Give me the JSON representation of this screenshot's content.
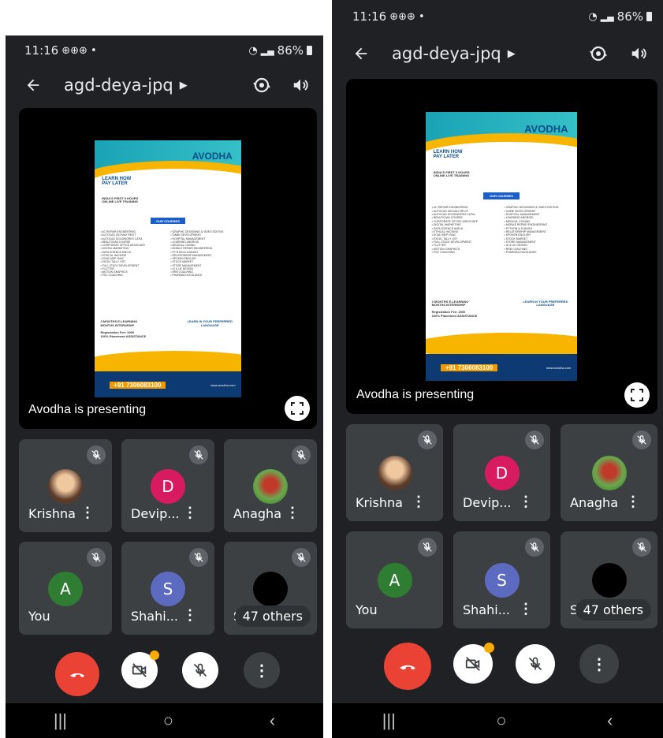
{
  "phones": [
    {
      "status": {
        "time": "11:16",
        "battery": "86%"
      },
      "meeting_code": "agd-deya-jpq",
      "presenting_label": "Avodha is presenting",
      "tiles": [
        {
          "name": "Krishna",
          "avatar_letter": "",
          "avatar_color": "#8d6e63"
        },
        {
          "name": "Devip...",
          "avatar_letter": "D",
          "avatar_color": "#d81b60"
        },
        {
          "name": "Anagha",
          "avatar_letter": "",
          "avatar_color": "#4caf50"
        },
        {
          "name": "You",
          "avatar_letter": "A",
          "avatar_color": "#2e7d32"
        },
        {
          "name": "Shahi...",
          "avatar_letter": "S",
          "avatar_color": "#5c6bc0"
        },
        {
          "name": "Sr",
          "avatar_letter": "",
          "avatar_color": "#000000",
          "others_label": "47 others"
        }
      ]
    },
    {
      "status": {
        "time": "11:16",
        "battery": "86%"
      },
      "meeting_code": "agd-deya-jpq",
      "presenting_label": "Avodha is presenting",
      "tiles": [
        {
          "name": "Krishna",
          "avatar_letter": "",
          "avatar_color": "#8d6e63"
        },
        {
          "name": "Devip...",
          "avatar_letter": "D",
          "avatar_color": "#d81b60"
        },
        {
          "name": "Anagha",
          "avatar_letter": "",
          "avatar_color": "#4caf50"
        },
        {
          "name": "You",
          "avatar_letter": "A",
          "avatar_color": "#2e7d32"
        },
        {
          "name": "Shahi...",
          "avatar_letter": "S",
          "avatar_color": "#5c6bc0"
        },
        {
          "name": "Sr",
          "avatar_letter": "",
          "avatar_color": "#000000",
          "others_label": "47 others"
        }
      ]
    }
  ],
  "poster": {
    "brand": "AVODHA",
    "headline_1": "LEARN HOW",
    "headline_2": "PAY LATER",
    "sub_1": "INDIA'S FIRST 9 HOURS",
    "sub_2": "ONLINE LIVE TRAINING",
    "courses_bar": "OUR COURSES",
    "courses_left": "• AC REPAIR ENGINEERING\n• AUTOCAD 2D3 MAX REVIT\n• AUTOCAD SOLIDWORKS CATIA\n• BEAUTICIAN COURSE\n• CORPORATE OFFICE ASSOCIATE\n• DIGITAL MARKETING\n• DATA SCIENCE AND AI\n• ETHICAL HACKING\n• ECAD MEP HVAC\n• EXCEL TALLY GST\n• FULL STACK DEVELOPMENT\n• FLUTTER\n• MOTION GRAPHICS\n• PSC COACHING",
    "courses_right": "• GRAPHIC DESIGNING & VIDEO EDITING\n• GAME DEVELOPMENT\n• HOSPITAL MANAGEMENT\n• LEARNING ANDROID\n• MEDICAL CODING\n• MOBILE REPAIR ENGINEERING\n• PYTHON & DJANGO\n• RELATIONSHIP MANAGEMENT\n• SPOKEN ENGLISH\n• STOCK MARKET\n• STORE MANAGEMENT\n• UI & UX DESIGN\n• RRB COACHING\n• PHARMACOVIGILANCE",
    "internship": "3 MONTHS E-LEARNING\nMONTHS INTERNSHIP",
    "registration": "Registration Fee: 2000\n100% Placement ASSISTANCE",
    "language_title": "LEARN IN YOUR PREFERRED\nLANGUAGE",
    "phone": "+91 7306083100",
    "website": "www.avodha.com"
  }
}
